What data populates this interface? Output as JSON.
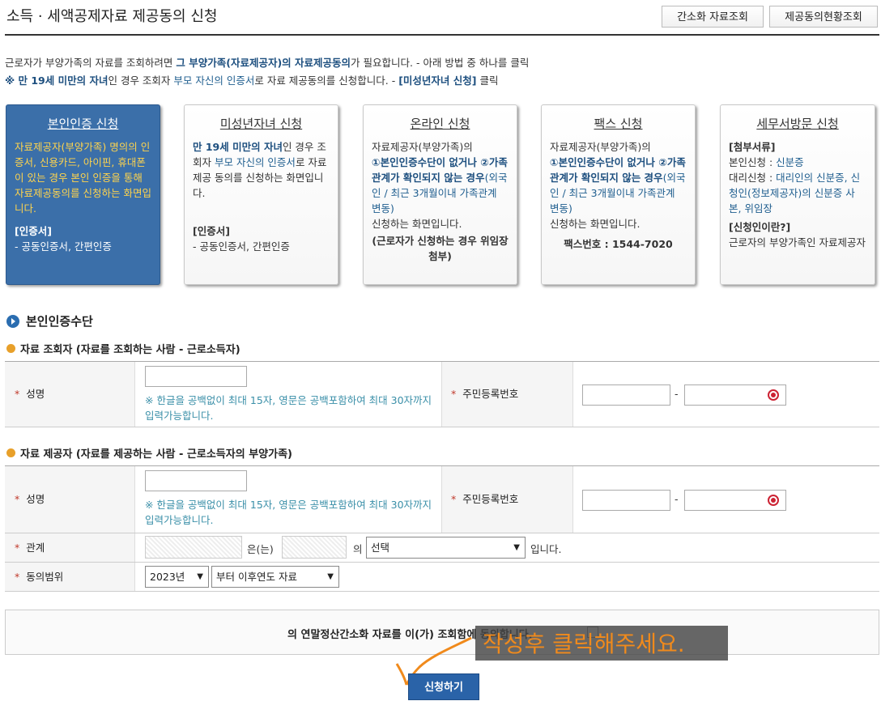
{
  "header": {
    "title": "소득 · 세액공제자료 제공동의 신청",
    "btn_simple": "간소화 자료조회",
    "btn_status": "제공동의현황조회"
  },
  "intro": {
    "l1a": "근로자가 부양가족의 자료를 조회하려면 ",
    "l1b": "그 부양가족(자료제공자)의 자료제공동의",
    "l1c": "가 필요합니다. - 아래 방법 중 하나를 클릭",
    "l2a": "※ 만 19세 미만의 자녀",
    "l2b": "인 경우 조회자 ",
    "l2c": "부모 자신의 인증서",
    "l2d": "로 자료 제공동의를 신청합니다. - ",
    "l2e": "[미성년자녀 신청]",
    "l2f": " 클릭"
  },
  "cards": {
    "self": {
      "title": "본인인증 신청",
      "body": "자료제공자(부양가족) 명의의 인증서, 신용카드, 아이핀, 휴대폰이 있는 경우 본인 인증을 통해 자료제공동의를 신청하는 화면입니다.",
      "sect": "[인증서]",
      "sect_body": "- 공동인증서, 간편인증"
    },
    "minor": {
      "title": "미성년자녀 신청",
      "b1": "만 19세 미만의 자녀",
      "b2": "인 경우 조회자 ",
      "b3": "부모 자신의 인증서",
      "b4": "로 자료 제공 동의를 신청하는 화면입니다.",
      "sect": "[인증서]",
      "sect_body": "- 공동인증서, 간편인증"
    },
    "online": {
      "title": "온라인 신청",
      "b1": "자료제공자(부양가족)의",
      "b2": "①본인인증수단이 없거나 ②가족관계가 확인되지 않는 경우",
      "b3": "(외국인 / 최근 3개월이내 가족관계 변동)",
      "b4": "신청하는 화면입니다.",
      "b5": "(근로자가 신청하는 경우 위임장 첨부)"
    },
    "fax": {
      "title": "팩스 신청",
      "b1": "자료제공자(부양가족)의",
      "b2": "①본인인증수단이 없거나 ②가족관계가 확인되지 않는 경우",
      "b3": "(외국인 / 최근 3개월이내 가족관계 변동)",
      "b4": "신청하는 화면입니다.",
      "b5": "팩스번호 : 1544-7020"
    },
    "visit": {
      "title": "세무서방문 신청",
      "sect1": "[첨부서류]",
      "r1a": "본인신청 : ",
      "r1b": "신분증",
      "r2a": "대리신청 : ",
      "r2b": "대리인의 신분증, 신청인(정보제공자)의 신분증 사본, 위임장",
      "sect2": "[신청인이란?]",
      "r3": "근로자의 부양가족인 자료제공자"
    }
  },
  "section": {
    "title": "본인인증수단",
    "viewer_head": "자료 조회자 (자료를 조회하는 사람 - 근로소득자)",
    "provider_head": "자료 제공자 (자료를 제공하는 사람 - 근로소득자의 부양가족)"
  },
  "form": {
    "name_label": "성명",
    "rrn_label": "주민등록번호",
    "name_note": "※ 한글을 공백없이 최대 15자, 영문은 공백포함하여 최대 30자까지 입력가능합니다.",
    "dash": "-",
    "relation_label": "관계",
    "rel_eun": "은(는)",
    "rel_ui": "의",
    "rel_select": "선택",
    "rel_end": "입니다.",
    "consent_label": "동의범위",
    "year_select": "2023년",
    "range_select": "부터 이후연도 자료"
  },
  "agree": {
    "text": "의 연말정산간소화 자료를 이(가) 조회함에 동의합니다.",
    "overlay": "작성후 클릭해주세요."
  },
  "submit": "신청하기"
}
